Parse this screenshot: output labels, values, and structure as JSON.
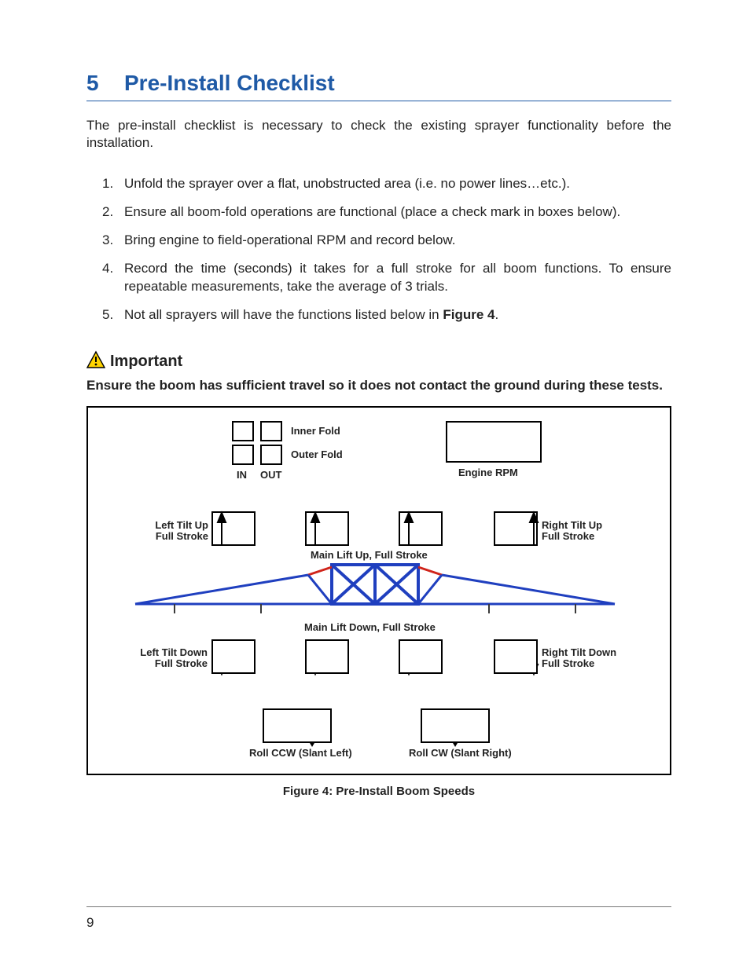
{
  "section": {
    "number": "5",
    "title": "Pre-Install Checklist"
  },
  "intro": "The pre-install checklist is necessary to check the existing sprayer functionality before the installation.",
  "checklist": {
    "items": [
      "Unfold the sprayer over a flat, unobstructed area (i.e. no power lines…etc.).",
      "Ensure all boom-fold operations are functional (place a check mark in boxes below).",
      "Bring engine to field-operational RPM and record below.",
      "Record the time (seconds) it takes for a full stroke for all boom functions.  To ensure repeatable measurements, take the average of 3 trials."
    ],
    "item5_prefix": "Not all sprayers will have the functions listed below in ",
    "item5_bold": "Figure 4",
    "item5_suffix": "."
  },
  "important": {
    "heading": "Important",
    "text": "Ensure the boom has sufficient travel so it does not contact the ground during these tests."
  },
  "figure": {
    "caption": "Figure 4: Pre-Install Boom Speeds",
    "labels": {
      "inner_fold": "Inner Fold",
      "outer_fold": "Outer Fold",
      "in": "IN",
      "out": "OUT",
      "engine_rpm": "Engine RPM",
      "left_tilt_up1": "Left Tilt Up",
      "left_tilt_up2": "Full Stroke",
      "right_tilt_up1": "Right Tilt Up",
      "right_tilt_up2": "Full Stroke",
      "main_up": "Main Lift Up, Full Stroke",
      "main_down": "Main Lift Down, Full Stroke",
      "left_tilt_down1": "Left Tilt Down",
      "left_tilt_down2": "Full Stroke",
      "right_tilt_down1": "Right Tilt  Down",
      "right_tilt_down2": "Full Stroke",
      "roll_ccw": "Roll CCW (Slant Left)",
      "roll_cw": "Roll CW (Slant Right)"
    }
  },
  "page_number": "9"
}
